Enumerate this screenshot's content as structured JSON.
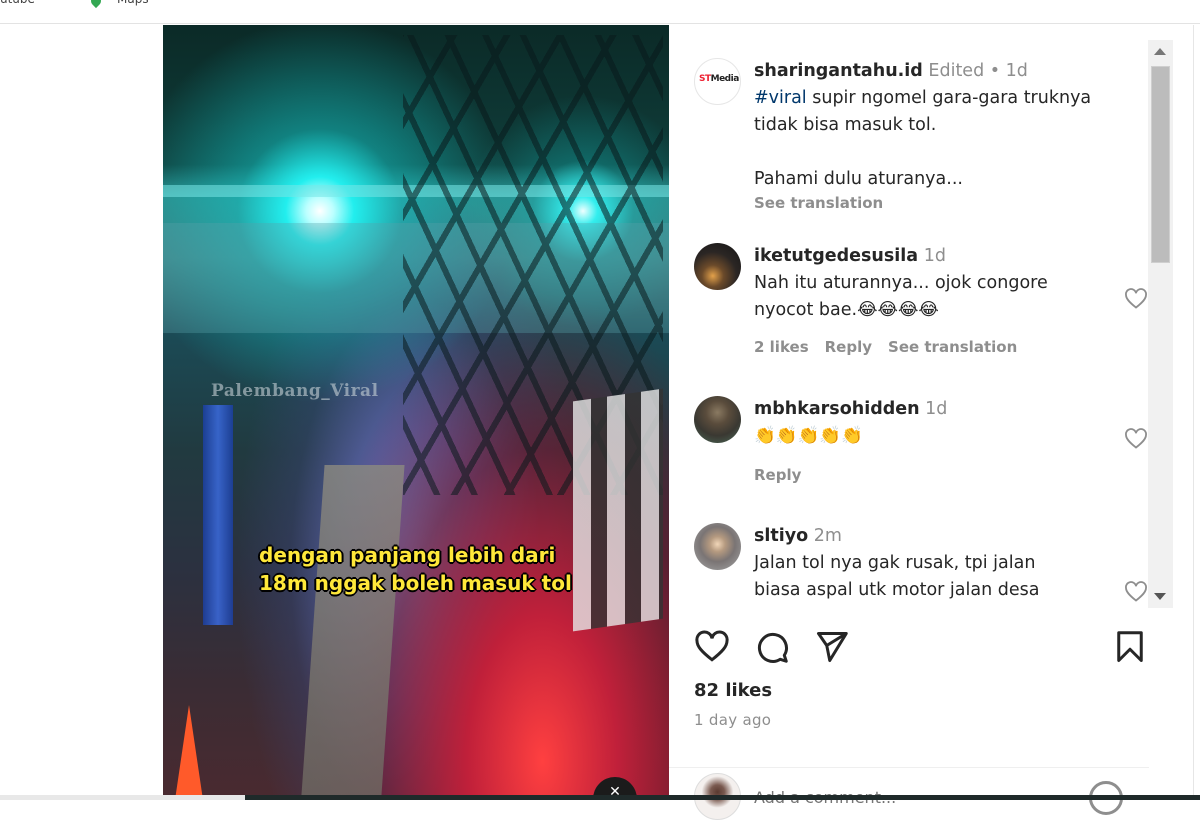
{
  "browser": {
    "bookmarks": [
      {
        "label": "utube",
        "icon": "youtube-icon"
      },
      {
        "label": "Maps",
        "icon": "maps-pin-icon"
      }
    ]
  },
  "media": {
    "watermark": "Palembang_Viral",
    "caption_line1": "dengan panjang lebih dari",
    "caption_line2": "18m nggak boleh masuk tol",
    "mute_icon": "speaker-muted-icon",
    "mute_glyph": "✕"
  },
  "post": {
    "author": {
      "username": "sharingantahu.id",
      "avatar_logo_red": "ST",
      "avatar_logo_dark": "Media"
    },
    "edited_label": "Edited",
    "dot": "•",
    "age": "1d",
    "caption_hashtag": "#viral",
    "caption_text": " supir ngomel gara-gara truknya tidak bisa masuk tol.",
    "caption_line2": "Pahami dulu aturanya...",
    "see_translation": "See translation",
    "likes": "82 likes",
    "time_ago": "1 day ago",
    "add_comment_placeholder": "Add a comment..."
  },
  "comments": [
    {
      "username": "iketutgedesusila",
      "age": "1d",
      "text": "Nah itu aturannya... ojok congore nyocot bae.😂😂😂😂",
      "likes": "2 likes",
      "reply": "Reply",
      "see_translation": "See translation"
    },
    {
      "username": "mbhkarsohidden",
      "age": "1d",
      "text": "👏👏👏👏👏",
      "reply": "Reply"
    },
    {
      "username": "sltiyo",
      "age": "2m",
      "text": "Jalan tol nya gak rusak, tpi jalan biasa aspal utk motor jalan desa"
    }
  ],
  "colors": {
    "text": "#262626",
    "muted": "#8e8e8e",
    "hashtag": "#00376b",
    "caption_yellow": "#ffe83a"
  }
}
